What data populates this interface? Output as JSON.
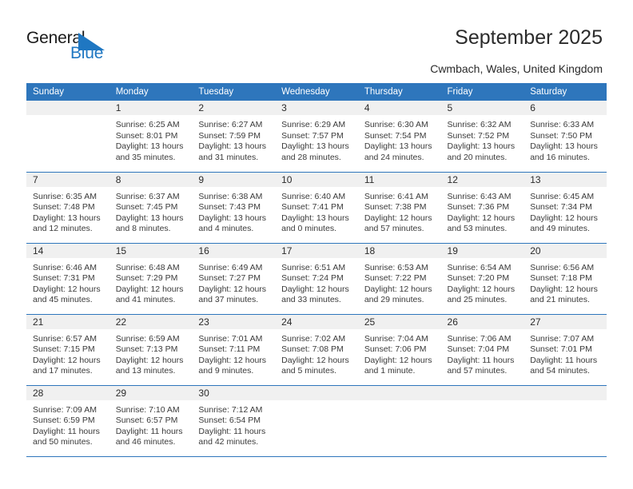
{
  "brand": {
    "name_part1": "General",
    "name_part2": "Blue",
    "color_primary": "#1f77c2",
    "color_dark": "#1a1a1a"
  },
  "header": {
    "title": "September 2025",
    "subtitle": "Cwmbach, Wales, United Kingdom"
  },
  "theme": {
    "header_row_bg": "#2e76bc",
    "daynum_bg": "#f0f0f0",
    "border_color": "#2e76bc",
    "text_color": "#3a3a3a"
  },
  "weekdays": [
    "Sunday",
    "Monday",
    "Tuesday",
    "Wednesday",
    "Thursday",
    "Friday",
    "Saturday"
  ],
  "labels": {
    "sunrise": "Sunrise:",
    "sunset": "Sunset:",
    "daylight": "Daylight:"
  },
  "weeks": [
    [
      {
        "day": "",
        "empty": true
      },
      {
        "day": "1",
        "sunrise": "Sunrise: 6:25 AM",
        "sunset": "Sunset: 8:01 PM",
        "daylight1": "Daylight: 13 hours",
        "daylight2": "and 35 minutes."
      },
      {
        "day": "2",
        "sunrise": "Sunrise: 6:27 AM",
        "sunset": "Sunset: 7:59 PM",
        "daylight1": "Daylight: 13 hours",
        "daylight2": "and 31 minutes."
      },
      {
        "day": "3",
        "sunrise": "Sunrise: 6:29 AM",
        "sunset": "Sunset: 7:57 PM",
        "daylight1": "Daylight: 13 hours",
        "daylight2": "and 28 minutes."
      },
      {
        "day": "4",
        "sunrise": "Sunrise: 6:30 AM",
        "sunset": "Sunset: 7:54 PM",
        "daylight1": "Daylight: 13 hours",
        "daylight2": "and 24 minutes."
      },
      {
        "day": "5",
        "sunrise": "Sunrise: 6:32 AM",
        "sunset": "Sunset: 7:52 PM",
        "daylight1": "Daylight: 13 hours",
        "daylight2": "and 20 minutes."
      },
      {
        "day": "6",
        "sunrise": "Sunrise: 6:33 AM",
        "sunset": "Sunset: 7:50 PM",
        "daylight1": "Daylight: 13 hours",
        "daylight2": "and 16 minutes."
      }
    ],
    [
      {
        "day": "7",
        "sunrise": "Sunrise: 6:35 AM",
        "sunset": "Sunset: 7:48 PM",
        "daylight1": "Daylight: 13 hours",
        "daylight2": "and 12 minutes."
      },
      {
        "day": "8",
        "sunrise": "Sunrise: 6:37 AM",
        "sunset": "Sunset: 7:45 PM",
        "daylight1": "Daylight: 13 hours",
        "daylight2": "and 8 minutes."
      },
      {
        "day": "9",
        "sunrise": "Sunrise: 6:38 AM",
        "sunset": "Sunset: 7:43 PM",
        "daylight1": "Daylight: 13 hours",
        "daylight2": "and 4 minutes."
      },
      {
        "day": "10",
        "sunrise": "Sunrise: 6:40 AM",
        "sunset": "Sunset: 7:41 PM",
        "daylight1": "Daylight: 13 hours",
        "daylight2": "and 0 minutes."
      },
      {
        "day": "11",
        "sunrise": "Sunrise: 6:41 AM",
        "sunset": "Sunset: 7:38 PM",
        "daylight1": "Daylight: 12 hours",
        "daylight2": "and 57 minutes."
      },
      {
        "day": "12",
        "sunrise": "Sunrise: 6:43 AM",
        "sunset": "Sunset: 7:36 PM",
        "daylight1": "Daylight: 12 hours",
        "daylight2": "and 53 minutes."
      },
      {
        "day": "13",
        "sunrise": "Sunrise: 6:45 AM",
        "sunset": "Sunset: 7:34 PM",
        "daylight1": "Daylight: 12 hours",
        "daylight2": "and 49 minutes."
      }
    ],
    [
      {
        "day": "14",
        "sunrise": "Sunrise: 6:46 AM",
        "sunset": "Sunset: 7:31 PM",
        "daylight1": "Daylight: 12 hours",
        "daylight2": "and 45 minutes."
      },
      {
        "day": "15",
        "sunrise": "Sunrise: 6:48 AM",
        "sunset": "Sunset: 7:29 PM",
        "daylight1": "Daylight: 12 hours",
        "daylight2": "and 41 minutes."
      },
      {
        "day": "16",
        "sunrise": "Sunrise: 6:49 AM",
        "sunset": "Sunset: 7:27 PM",
        "daylight1": "Daylight: 12 hours",
        "daylight2": "and 37 minutes."
      },
      {
        "day": "17",
        "sunrise": "Sunrise: 6:51 AM",
        "sunset": "Sunset: 7:24 PM",
        "daylight1": "Daylight: 12 hours",
        "daylight2": "and 33 minutes."
      },
      {
        "day": "18",
        "sunrise": "Sunrise: 6:53 AM",
        "sunset": "Sunset: 7:22 PM",
        "daylight1": "Daylight: 12 hours",
        "daylight2": "and 29 minutes."
      },
      {
        "day": "19",
        "sunrise": "Sunrise: 6:54 AM",
        "sunset": "Sunset: 7:20 PM",
        "daylight1": "Daylight: 12 hours",
        "daylight2": "and 25 minutes."
      },
      {
        "day": "20",
        "sunrise": "Sunrise: 6:56 AM",
        "sunset": "Sunset: 7:18 PM",
        "daylight1": "Daylight: 12 hours",
        "daylight2": "and 21 minutes."
      }
    ],
    [
      {
        "day": "21",
        "sunrise": "Sunrise: 6:57 AM",
        "sunset": "Sunset: 7:15 PM",
        "daylight1": "Daylight: 12 hours",
        "daylight2": "and 17 minutes."
      },
      {
        "day": "22",
        "sunrise": "Sunrise: 6:59 AM",
        "sunset": "Sunset: 7:13 PM",
        "daylight1": "Daylight: 12 hours",
        "daylight2": "and 13 minutes."
      },
      {
        "day": "23",
        "sunrise": "Sunrise: 7:01 AM",
        "sunset": "Sunset: 7:11 PM",
        "daylight1": "Daylight: 12 hours",
        "daylight2": "and 9 minutes."
      },
      {
        "day": "24",
        "sunrise": "Sunrise: 7:02 AM",
        "sunset": "Sunset: 7:08 PM",
        "daylight1": "Daylight: 12 hours",
        "daylight2": "and 5 minutes."
      },
      {
        "day": "25",
        "sunrise": "Sunrise: 7:04 AM",
        "sunset": "Sunset: 7:06 PM",
        "daylight1": "Daylight: 12 hours",
        "daylight2": "and 1 minute."
      },
      {
        "day": "26",
        "sunrise": "Sunrise: 7:06 AM",
        "sunset": "Sunset: 7:04 PM",
        "daylight1": "Daylight: 11 hours",
        "daylight2": "and 57 minutes."
      },
      {
        "day": "27",
        "sunrise": "Sunrise: 7:07 AM",
        "sunset": "Sunset: 7:01 PM",
        "daylight1": "Daylight: 11 hours",
        "daylight2": "and 54 minutes."
      }
    ],
    [
      {
        "day": "28",
        "sunrise": "Sunrise: 7:09 AM",
        "sunset": "Sunset: 6:59 PM",
        "daylight1": "Daylight: 11 hours",
        "daylight2": "and 50 minutes."
      },
      {
        "day": "29",
        "sunrise": "Sunrise: 7:10 AM",
        "sunset": "Sunset: 6:57 PM",
        "daylight1": "Daylight: 11 hours",
        "daylight2": "and 46 minutes."
      },
      {
        "day": "30",
        "sunrise": "Sunrise: 7:12 AM",
        "sunset": "Sunset: 6:54 PM",
        "daylight1": "Daylight: 11 hours",
        "daylight2": "and 42 minutes."
      },
      {
        "day": "",
        "empty": true
      },
      {
        "day": "",
        "empty": true
      },
      {
        "day": "",
        "empty": true
      },
      {
        "day": "",
        "empty": true
      }
    ]
  ]
}
